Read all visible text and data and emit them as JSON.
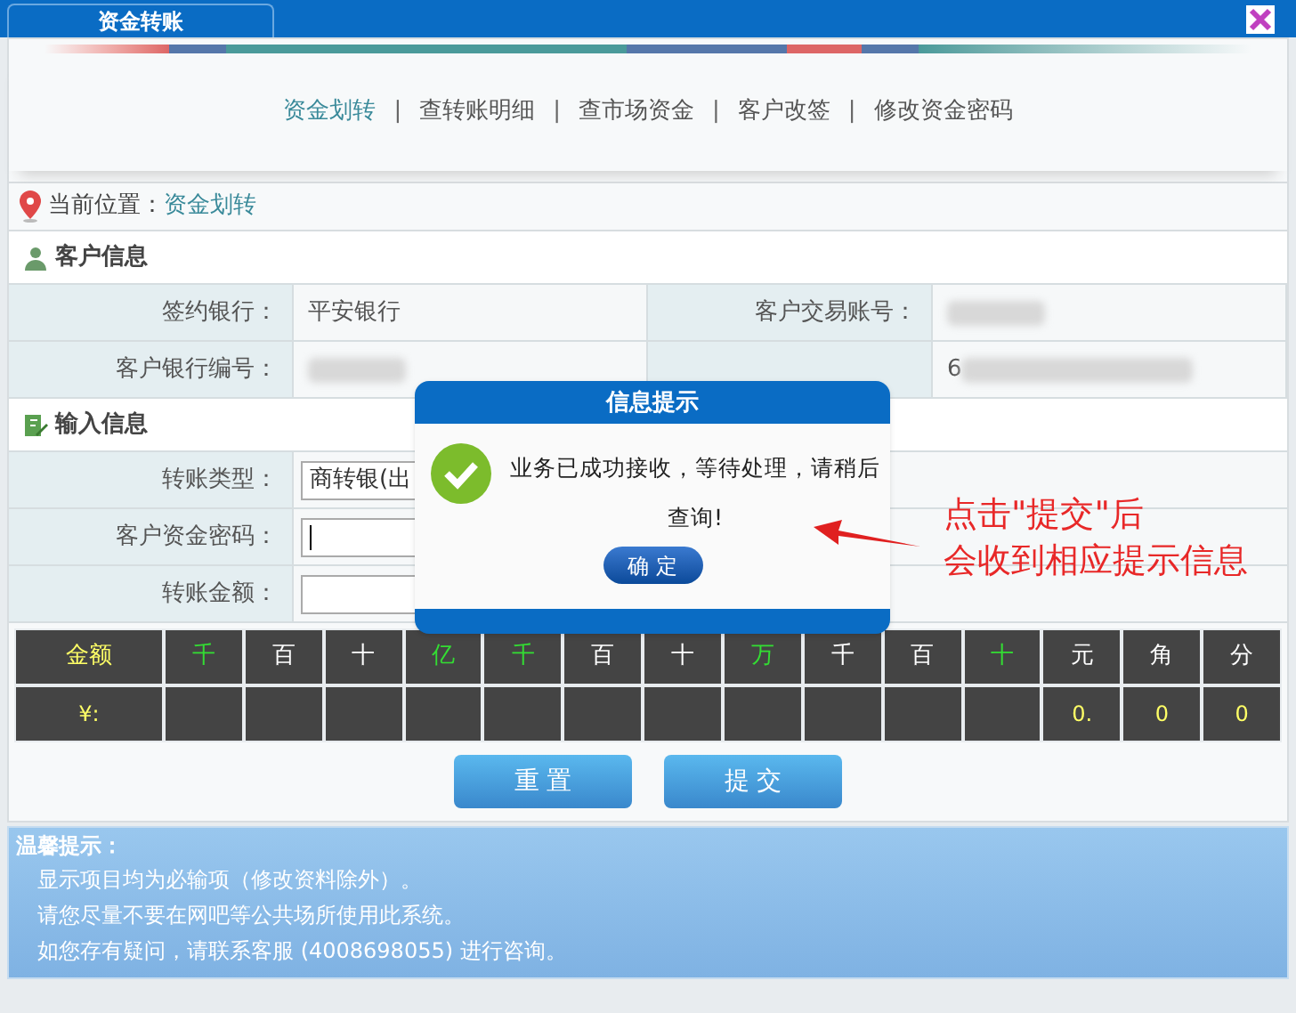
{
  "window": {
    "tab": "资金转账"
  },
  "nav": [
    {
      "label": "资金划转",
      "selected": true
    },
    {
      "label": "查转账明细",
      "selected": false
    },
    {
      "label": "查市场资金",
      "selected": false
    },
    {
      "label": "客户改签",
      "selected": false
    },
    {
      "label": "修改资金密码",
      "selected": false
    }
  ],
  "separator": "|",
  "location": {
    "label": "当前位置：",
    "value": "资金划转"
  },
  "customer_info": {
    "title": "客户信息",
    "rows": [
      [
        {
          "label": "签约银行：",
          "value": "平安银行"
        },
        {
          "label": "客户交易账号："
        }
      ],
      [
        {
          "label": "客户银行编号："
        },
        {
          "value": "6"
        }
      ]
    ]
  },
  "input_info": {
    "title": "输入信息",
    "fields": [
      {
        "kind": "select",
        "label": "转账类型：",
        "value": "商转银(出"
      },
      {
        "kind": "password",
        "label": "客户资金密码："
      },
      {
        "kind": "text",
        "label": "转账金额："
      }
    ]
  },
  "amount_table": {
    "header": [
      {
        "text": "金额",
        "color": "#ffff66"
      },
      {
        "text": "千",
        "color": "#33dd33"
      },
      {
        "text": "百",
        "color": "#ffffff"
      },
      {
        "text": "十",
        "color": "#ffffff"
      },
      {
        "text": "亿",
        "color": "#33dd33"
      },
      {
        "text": "千",
        "color": "#33dd33"
      },
      {
        "text": "百",
        "color": "#ffffff"
      },
      {
        "text": "十",
        "color": "#ffffff"
      },
      {
        "text": "万",
        "color": "#33dd33"
      },
      {
        "text": "千",
        "color": "#ffffff"
      },
      {
        "text": "百",
        "color": "#ffffff"
      },
      {
        "text": "十",
        "color": "#33dd33"
      },
      {
        "text": "元",
        "color": "#ffffff"
      },
      {
        "text": "角",
        "color": "#ffffff"
      },
      {
        "text": "分",
        "color": "#ffffff"
      }
    ],
    "row": {
      "currency": "¥:",
      "digits": [
        "0.",
        "0",
        "0"
      ]
    }
  },
  "buttons": [
    "重 置",
    "提 交"
  ],
  "tips": {
    "title": "温馨提示：",
    "lines": [
      "显示项目均为必输项（修改资料除外）。",
      "请您尽量不要在网吧等公共场所使用此系统。",
      "如您存有疑问，请联系客服 (4008698055) 进行咨询。"
    ]
  },
  "dialog": {
    "title": "信息提示",
    "message": "业务已成功接收，等待处理，请稍后查询!",
    "button": "确 定"
  },
  "annotation": {
    "lines": [
      "点击\"提交\"后",
      "会收到相应提示信息"
    ]
  }
}
